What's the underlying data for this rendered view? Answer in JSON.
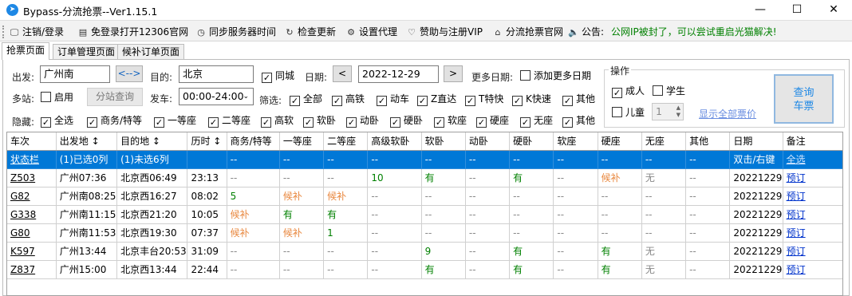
{
  "window": {
    "title": "Bypass-分流抢票--Ver1.15.1",
    "minimize": "—",
    "maximize": "☐",
    "close": "✕"
  },
  "menu": {
    "items": [
      {
        "icon": "🖵",
        "label": "注销/登录"
      },
      {
        "icon": "▤",
        "label": "免登录打开12306官网"
      },
      {
        "icon": "◷",
        "label": "同步服务器时间"
      },
      {
        "icon": "↻",
        "label": "检查更新"
      },
      {
        "icon": "⚙",
        "label": "设置代理"
      },
      {
        "icon": "♡",
        "label": "赞助与注册VIP"
      },
      {
        "icon": "⌂",
        "label": "分流抢票官网"
      },
      {
        "icon": "🔈",
        "label": "公告:"
      }
    ],
    "notice": "公网IP被封了，可以尝试重启光猫解决!"
  },
  "tabs": [
    "抢票页面",
    "订单管理页面",
    "候补订单页面"
  ],
  "form": {
    "from_label": "出发:",
    "from_value": "广州南",
    "swap": "<-->",
    "to_label": "目的:",
    "to_value": "北京",
    "same_city": "同城",
    "date_label": "日期:",
    "date_value": "2022-12-29",
    "prev": "<",
    "next": ">",
    "more_dates_label": "更多日期:",
    "add_more_dates": "添加更多日期",
    "multi_station_label": "多站:",
    "enable": "启用",
    "station_query": "分站查询",
    "depart_label": "发车:",
    "depart_time": "00:00-24:00",
    "filter_label": "筛选:",
    "filters": [
      "全部",
      "高铁",
      "动车",
      "Z直达",
      "T特快",
      "K快速",
      "其他"
    ],
    "hide_label": "隐藏:",
    "hide": [
      "全选",
      "商务/特等",
      "一等座",
      "二等座",
      "高软",
      "软卧",
      "动卧",
      "硬卧",
      "软座",
      "硬座",
      "无座",
      "其他"
    ]
  },
  "ops": {
    "legend": "操作",
    "adult": "成人",
    "student": "学生",
    "child": "儿童",
    "child_count": "1",
    "show_all_prices": "显示全部票价",
    "query_line1": "查询",
    "query_line2": "车票"
  },
  "table": {
    "headers": [
      "车次",
      "出发地 ↕",
      "目的地 ↕",
      "历时 ↕",
      "商务/特等",
      "一等座",
      "二等座",
      "高级软卧",
      "软卧",
      "动卧",
      "硬卧",
      "软座",
      "硬座",
      "无座",
      "其他",
      "日期",
      "备注"
    ],
    "rows": [
      [
        "状态栏",
        "(1)已选0列",
        "(1)未选6列",
        "",
        "--",
        "--",
        "--",
        "--",
        "--",
        "--",
        "--",
        "--",
        "--",
        "--",
        "--",
        "双击/右键",
        "全选"
      ],
      [
        "Z503",
        "广州07:36",
        "北京西06:49",
        "23:13",
        "--",
        "--",
        "--",
        "10",
        "有",
        "--",
        "有",
        "--",
        "候补",
        "无",
        "--",
        "20221229",
        "预订"
      ],
      [
        "G82",
        "广州南08:25",
        "北京西16:27",
        "08:02",
        "5",
        "候补",
        "候补",
        "--",
        "--",
        "--",
        "--",
        "--",
        "--",
        "--",
        "--",
        "20221229",
        "预订"
      ],
      [
        "G338",
        "广州南11:15",
        "北京西21:20",
        "10:05",
        "候补",
        "有",
        "有",
        "--",
        "--",
        "--",
        "--",
        "--",
        "--",
        "--",
        "--",
        "20221229",
        "预订"
      ],
      [
        "G80",
        "广州南11:53",
        "北京西19:30",
        "07:37",
        "候补",
        "候补",
        "1",
        "--",
        "--",
        "--",
        "--",
        "--",
        "--",
        "--",
        "--",
        "20221229",
        "预订"
      ],
      [
        "K597",
        "广州13:44",
        "北京丰台20:53",
        "31:09",
        "--",
        "--",
        "--",
        "--",
        "9",
        "--",
        "有",
        "--",
        "有",
        "无",
        "--",
        "20221229",
        "预订"
      ],
      [
        "Z837",
        "广州15:00",
        "北京西13:44",
        "22:44",
        "--",
        "--",
        "--",
        "--",
        "有",
        "--",
        "有",
        "--",
        "有",
        "无",
        "--",
        "20221229",
        "预订"
      ]
    ]
  },
  "colors": {
    "accent": "#0078d7",
    "available": "#008000",
    "waitlist": "#e9883f",
    "link": "#0033cc",
    "notice": "#008000"
  }
}
